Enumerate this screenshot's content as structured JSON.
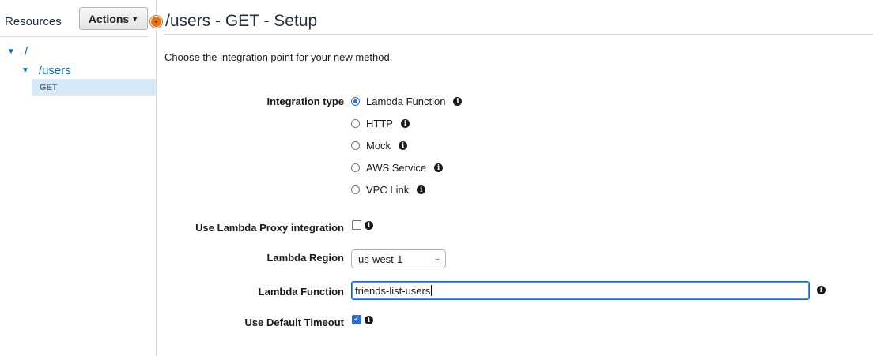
{
  "sidebar": {
    "title": "Resources",
    "actions_label": "Actions",
    "tree": {
      "root": "/",
      "users": "/users",
      "get": "GET"
    }
  },
  "header": {
    "title": "/users - GET - Setup"
  },
  "intro": "Choose the integration point for your new method.",
  "form": {
    "integration_type": {
      "label": "Integration type",
      "options": [
        "Lambda Function",
        "HTTP",
        "Mock",
        "AWS Service",
        "VPC Link"
      ],
      "selected": "Lambda Function"
    },
    "proxy": {
      "label": "Use Lambda Proxy integration",
      "checked": false
    },
    "region": {
      "label": "Lambda Region",
      "value": "us-west-1"
    },
    "function": {
      "label": "Lambda Function",
      "value": "friends-list-users"
    },
    "timeout": {
      "label": "Use Default Timeout",
      "checked": true
    }
  },
  "colors": {
    "accent": "#0073bb",
    "orange": "#ec7211",
    "selected_bg": "#d6eaf8"
  }
}
